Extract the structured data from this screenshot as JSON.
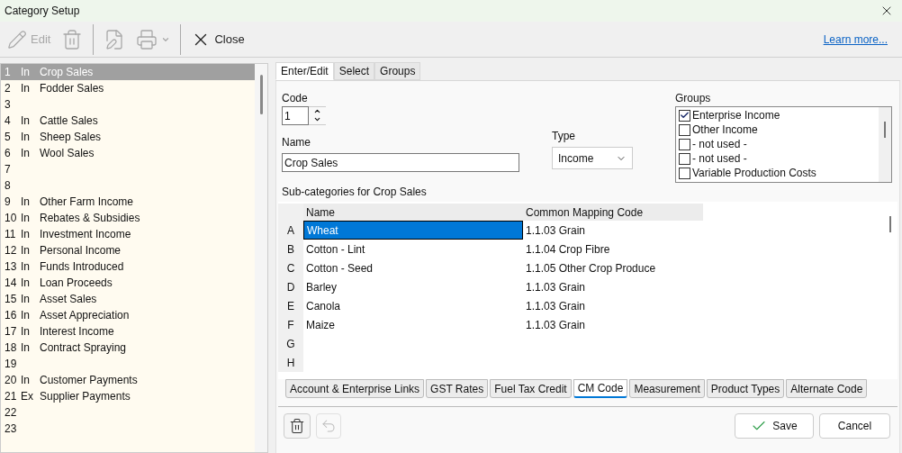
{
  "window": {
    "title": "Category Setup"
  },
  "toolbar": {
    "buttons": [
      {
        "kind": "edit",
        "label": "Edit",
        "disabled": true
      },
      {
        "kind": "delete",
        "disabled": true
      },
      {
        "kind": "form",
        "disabled": true
      },
      {
        "kind": "print",
        "disabled": true
      },
      {
        "kind": "close",
        "label": "Close",
        "disabled": false
      }
    ],
    "link": "Learn more..."
  },
  "categories": [
    {
      "code": "1",
      "type": "In",
      "name": "Crop Sales",
      "selected": true
    },
    {
      "code": "2",
      "type": "In",
      "name": "Fodder Sales",
      "selected": false
    },
    {
      "code": "3",
      "selected": false
    },
    {
      "code": "4",
      "type": "In",
      "name": "Cattle Sales",
      "selected": false
    },
    {
      "code": "5",
      "type": "In",
      "name": "Sheep Sales",
      "selected": false
    },
    {
      "code": "6",
      "type": "In",
      "name": "Wool Sales",
      "selected": false
    },
    {
      "code": "7",
      "selected": false
    },
    {
      "code": "8",
      "selected": false
    },
    {
      "code": "9",
      "type": "In",
      "name": "Other Farm Income",
      "selected": false
    },
    {
      "code": "10",
      "type": "In",
      "name": "Rebates & Subsidies",
      "selected": false
    },
    {
      "code": "11",
      "type": "In",
      "name": "Investment Income",
      "selected": false
    },
    {
      "code": "12",
      "type": "In",
      "name": "Personal Income",
      "selected": false
    },
    {
      "code": "13",
      "type": "In",
      "name": "Funds Introduced",
      "selected": false
    },
    {
      "code": "14",
      "type": "In",
      "name": "Loan Proceeds",
      "selected": false
    },
    {
      "code": "15",
      "type": "In",
      "name": "Asset Sales",
      "selected": false
    },
    {
      "code": "16",
      "type": "In",
      "name": "Asset Appreciation",
      "selected": false
    },
    {
      "code": "17",
      "type": "In",
      "name": "Interest Income",
      "selected": false
    },
    {
      "code": "18",
      "type": "In",
      "name": "Contract Spraying",
      "selected": false
    },
    {
      "code": "19",
      "selected": false
    },
    {
      "code": "20",
      "type": "In",
      "name": "Customer Payments",
      "selected": false
    },
    {
      "code": "21",
      "type": "Ex",
      "name": "Supplier Payments",
      "selected": false
    },
    {
      "code": "22",
      "selected": false
    },
    {
      "code": "23",
      "selected": false
    }
  ],
  "tabs": [
    {
      "label": "Enter/Edit",
      "selected": true
    },
    {
      "label": "Select",
      "selected": false
    },
    {
      "label": "Groups",
      "selected": false
    }
  ],
  "form": {
    "code_label": "Code",
    "code": "1",
    "name_label": "Name",
    "name": "Crop Sales",
    "type_label": "Type",
    "type": "Income",
    "groups_label": "Groups",
    "groups": [
      {
        "label": "Enterprise Income",
        "checked": true
      },
      {
        "label": "Other Income",
        "checked": false
      },
      {
        "label": "- not used -",
        "checked": false
      },
      {
        "label": "- not used -",
        "checked": false
      },
      {
        "label": "Variable Production Costs",
        "checked": false
      }
    ],
    "subcategories_label": "Sub-categories for Crop Sales"
  },
  "grid": {
    "columns": [
      "Name",
      "Common Mapping Code"
    ],
    "rows": [
      {
        "key": "A",
        "name": "Wheat",
        "code": "1.1.03 Grain",
        "selected": true
      },
      {
        "key": "B",
        "name": "Cotton - Lint",
        "code": "1.1.04 Crop Fibre",
        "selected": false
      },
      {
        "key": "C",
        "name": "Cotton - Seed",
        "code": "1.1.05 Other Crop Produce",
        "selected": false
      },
      {
        "key": "D",
        "name": "Barley",
        "code": "1.1.03 Grain",
        "selected": false
      },
      {
        "key": "E",
        "name": "Canola",
        "code": "1.1.03 Grain",
        "selected": false
      },
      {
        "key": "F",
        "name": "Maize",
        "code": "1.1.03 Grain",
        "selected": false
      },
      {
        "key": "G",
        "selected": false
      },
      {
        "key": "H",
        "selected": false
      }
    ]
  },
  "bottom_tabs": [
    {
      "label": "Account & Enterprise Links",
      "selected": false
    },
    {
      "label": "GST Rates",
      "selected": false
    },
    {
      "label": "Fuel Tax Credit",
      "selected": false
    },
    {
      "label": "CM Code",
      "selected": true
    },
    {
      "label": "Measurement",
      "selected": false
    },
    {
      "label": "Product Types",
      "selected": false
    },
    {
      "label": "Alternate Code",
      "selected": false
    }
  ],
  "footer": {
    "delete_disabled": false,
    "undo_disabled": true,
    "save": "Save",
    "cancel": "Cancel"
  }
}
